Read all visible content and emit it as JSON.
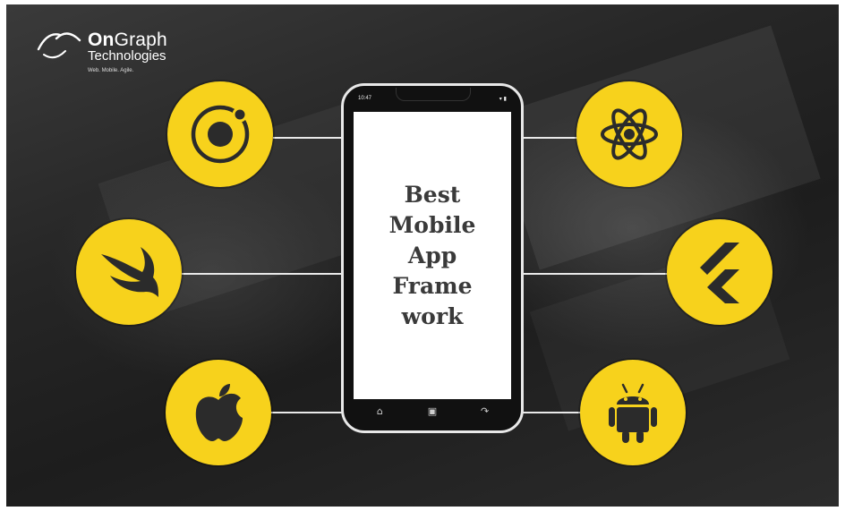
{
  "logo": {
    "name_bold": "On",
    "name_rest": "Graph",
    "subtitle": "Technologies",
    "tagline": "Web. Mobile. Agile."
  },
  "phone": {
    "status_time": "10:47",
    "status_icons": "▾ ▮",
    "screen_lines": [
      "Best",
      "Mobile",
      "App",
      "Frame",
      "work"
    ],
    "nav_icons": [
      "home-icon",
      "recent-apps-icon",
      "back-icon"
    ]
  },
  "frameworks": {
    "left": [
      "ionic-icon",
      "swift-icon",
      "apple-icon"
    ],
    "right": [
      "react-icon",
      "flutter-icon",
      "android-icon"
    ]
  },
  "colors": {
    "accent": "#f7d21c",
    "icon": "#2b2b2b",
    "background": "#262626",
    "phone_screen": "#ffffff",
    "title_text": "#3a3a3a"
  }
}
